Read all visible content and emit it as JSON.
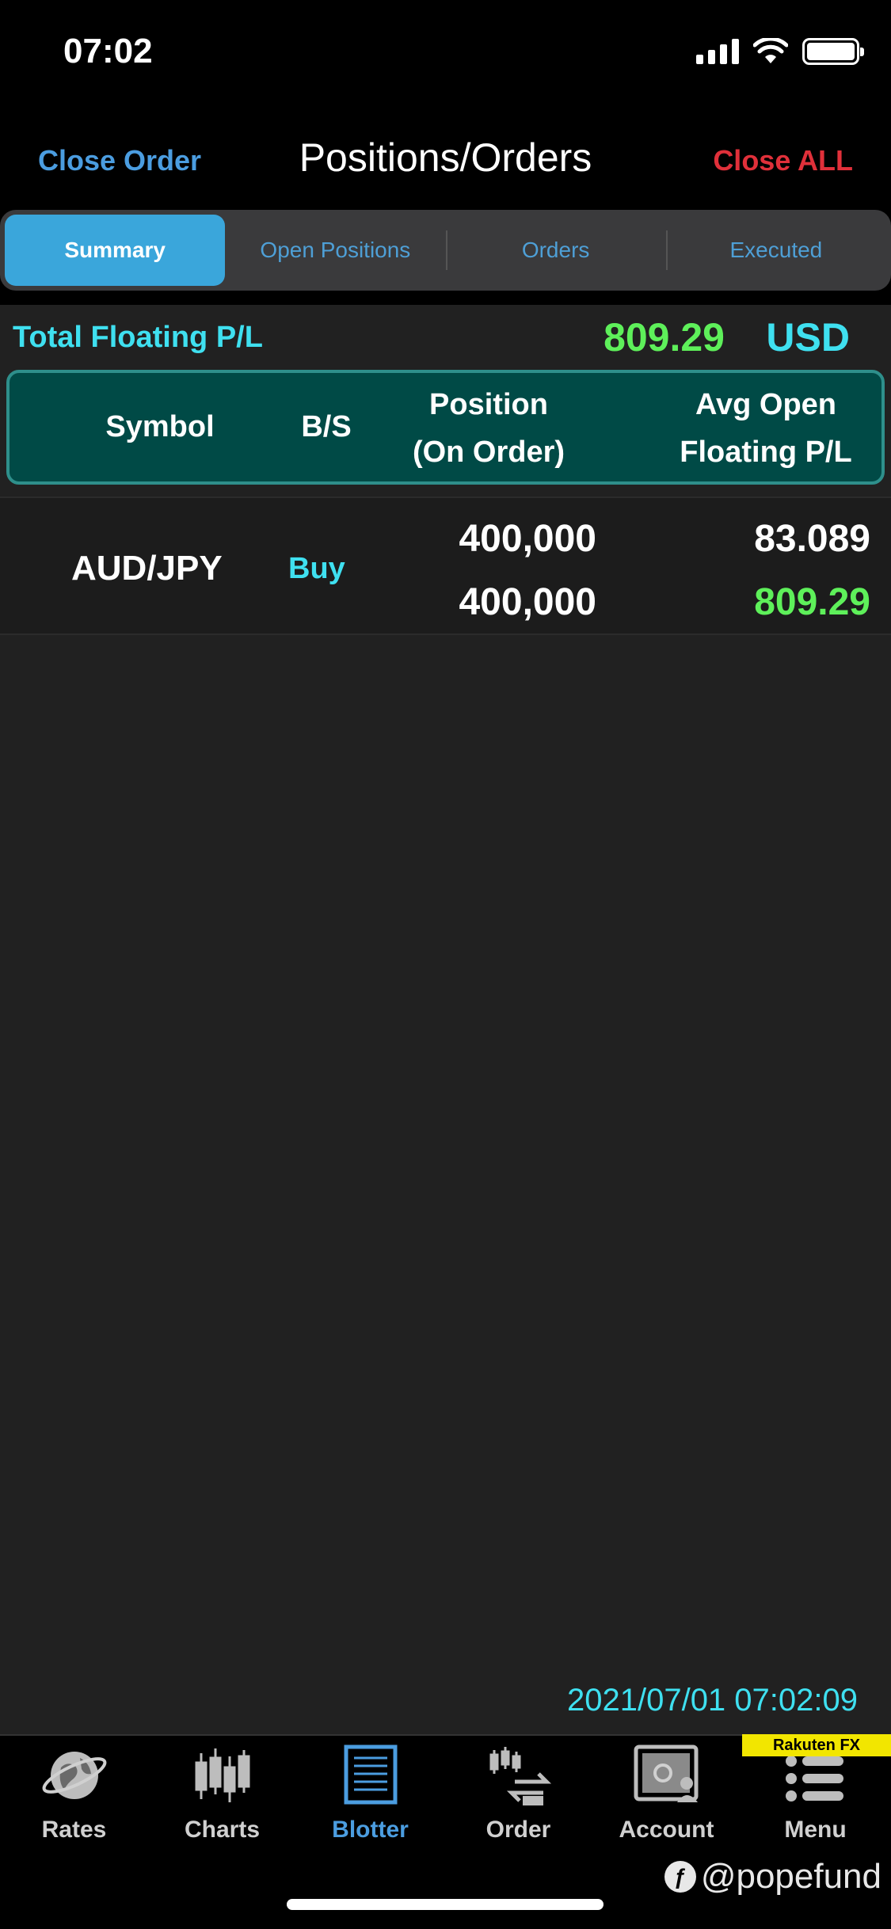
{
  "status_bar": {
    "time": "07:02"
  },
  "nav": {
    "left": "Close Order",
    "title": "Positions/Orders",
    "right": "Close ALL"
  },
  "tabs": [
    {
      "label": "Summary",
      "active": true
    },
    {
      "label": "Open Positions",
      "active": false
    },
    {
      "label": "Orders",
      "active": false
    },
    {
      "label": "Executed",
      "active": false
    }
  ],
  "total": {
    "label": "Total Floating P/L",
    "value": "809.29",
    "currency": "USD"
  },
  "table": {
    "headers": {
      "symbol": "Symbol",
      "bs": "B/S",
      "position_line1": "Position",
      "position_line2": "(On Order)",
      "avg_line1": "Avg Open",
      "avg_line2": "Floating P/L"
    },
    "rows": [
      {
        "symbol": "AUD/JPY",
        "bs": "Buy",
        "position": "400,000",
        "on_order": "400,000",
        "avg_open": "83.089",
        "floating_pl": "809.29"
      }
    ]
  },
  "timestamp": "2021/07/01 07:02:09",
  "tab_bar": [
    {
      "label": "Rates",
      "icon": "globe-icon"
    },
    {
      "label": "Charts",
      "icon": "candlestick-icon"
    },
    {
      "label": "Blotter",
      "icon": "blotter-icon",
      "active": true
    },
    {
      "label": "Order",
      "icon": "order-icon"
    },
    {
      "label": "Account",
      "icon": "safe-icon"
    },
    {
      "label": "Menu",
      "icon": "menu-icon"
    }
  ],
  "brand": "Rakuten FX",
  "watermark": "@popefund",
  "colors": {
    "accent_blue": "#4b9de0",
    "cyan": "#3fe0f0",
    "profit_green": "#5ef05a",
    "close_all_red": "#e0303a",
    "header_teal": "#004a46"
  }
}
